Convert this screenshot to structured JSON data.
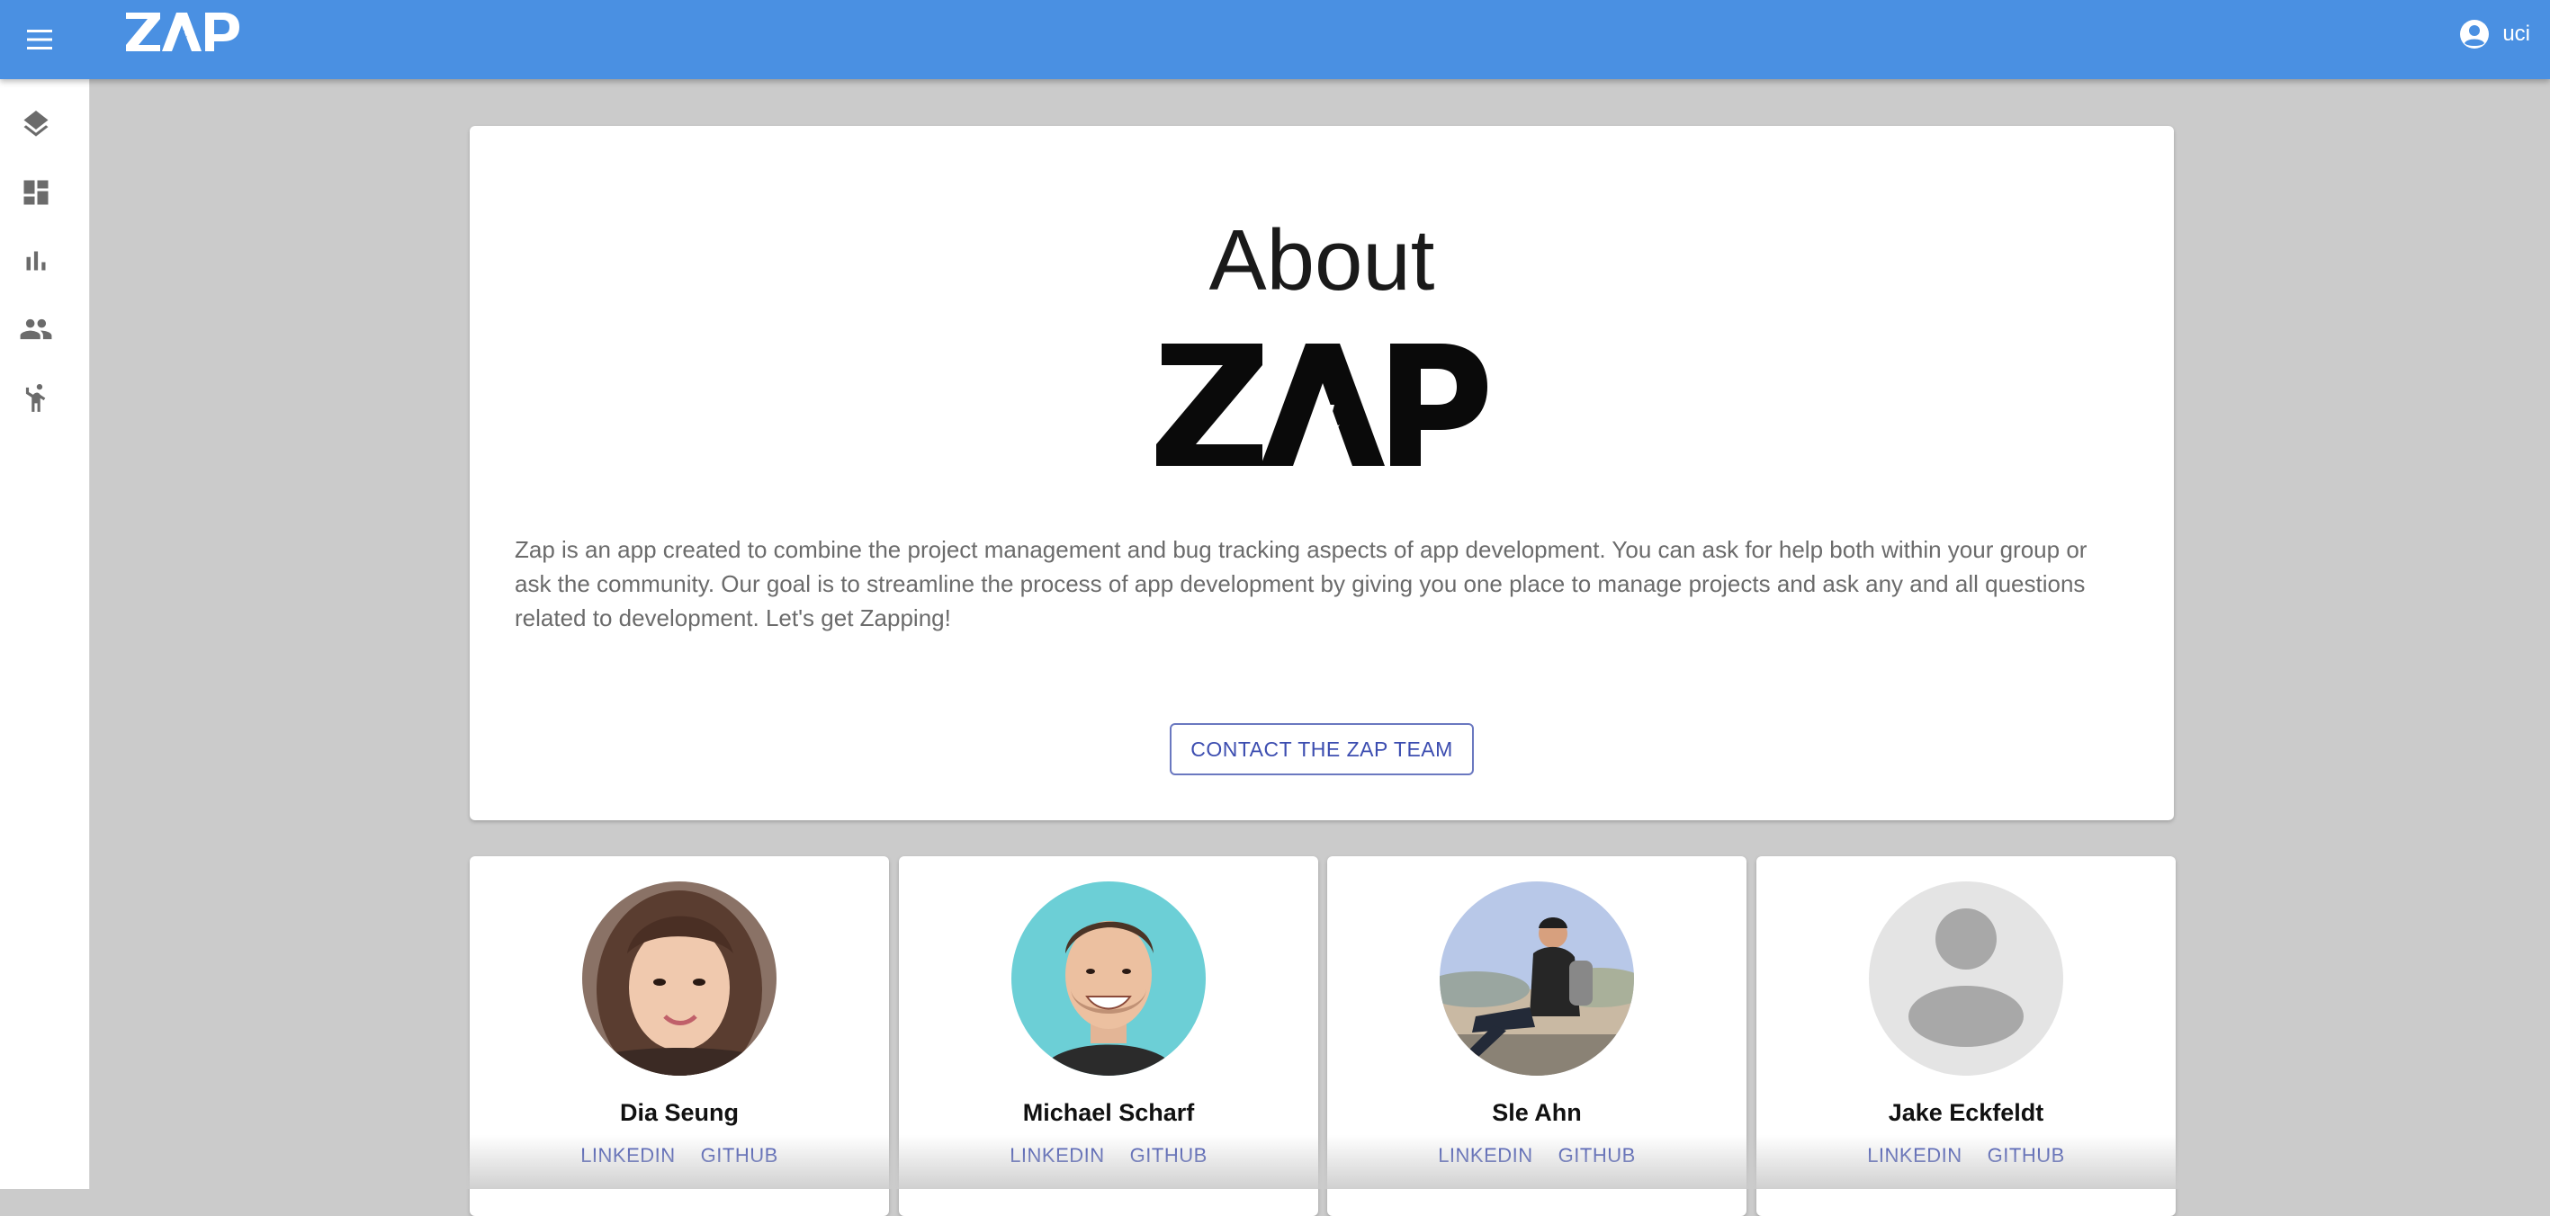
{
  "header": {
    "brand": "ZAP",
    "user_label": "uci",
    "menu_icon": "menu-icon",
    "user_icon": "account-circle-icon",
    "background_color": "#4a90e2"
  },
  "sidebar": {
    "items": [
      {
        "icon": "layers-icon"
      },
      {
        "icon": "dashboard-icon"
      },
      {
        "icon": "bar-chart-icon"
      },
      {
        "icon": "people-icon"
      },
      {
        "icon": "accessibility-person-icon"
      }
    ]
  },
  "about": {
    "title": "About",
    "logo_text": "ZAP",
    "description": "Zap is an app created to combine the project management and bug tracking aspects of app development. You can ask for help both within your group or ask the community. Our goal is to streamline the process of app development by giving you one place to manage projects and ask any and all questions related to development. Let's get Zapping!",
    "contact_button": "CONTACT THE ZAP TEAM",
    "accent_color": "#3c4db0"
  },
  "team": [
    {
      "name": "Dia Seung",
      "linkedin": "LINKEDIN",
      "github": "GITHUB"
    },
    {
      "name": "Michael Scharf",
      "linkedin": "LINKEDIN",
      "github": "GITHUB"
    },
    {
      "name": "Sle Ahn",
      "linkedin": "LINKEDIN",
      "github": "GITHUB"
    },
    {
      "name": "Jake Eckfeldt",
      "linkedin": "LINKEDIN",
      "github": "GITHUB"
    }
  ]
}
